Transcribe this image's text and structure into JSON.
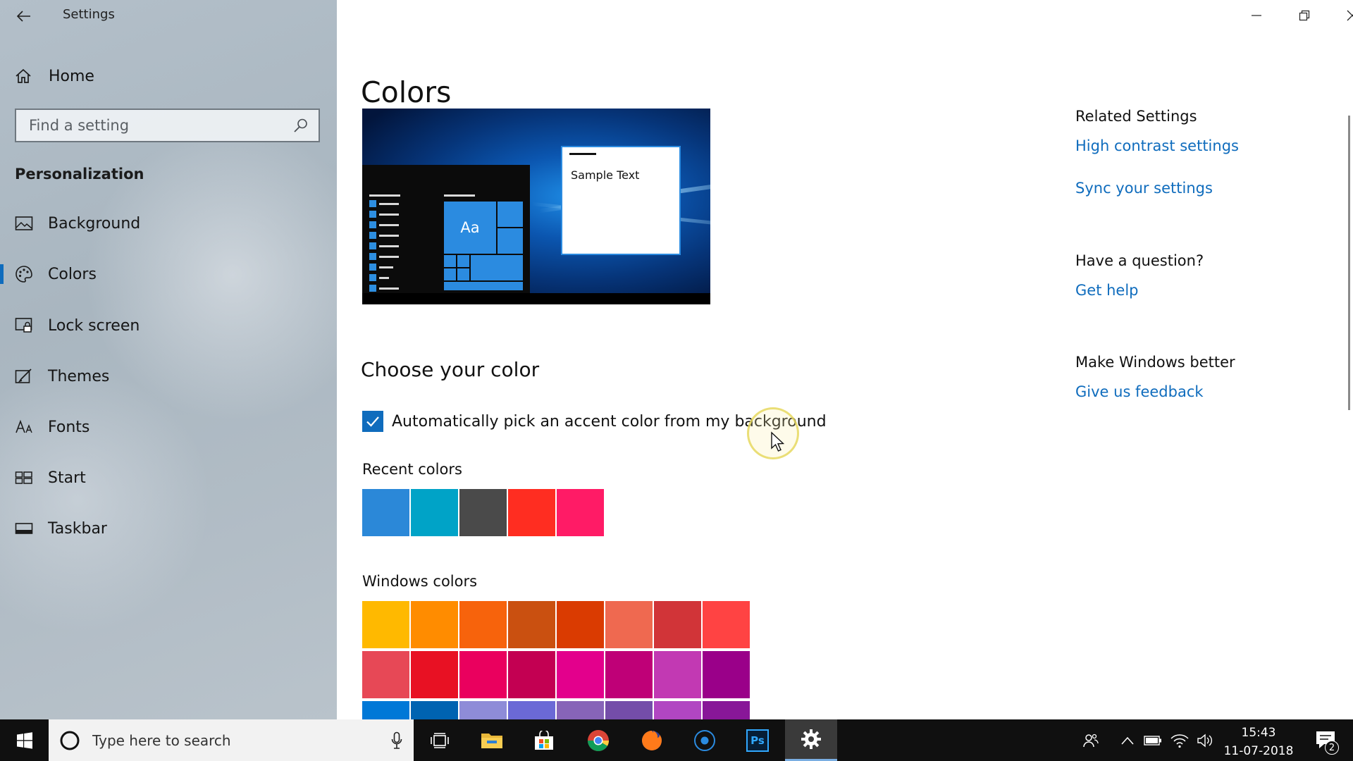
{
  "window": {
    "title": "Settings",
    "minimize_icon": "minimize-icon",
    "restore_icon": "restore-icon",
    "close_icon": "close-icon"
  },
  "sidebar": {
    "home_label": "Home",
    "search_placeholder": "Find a setting",
    "section_title": "Personalization",
    "selected": "Colors",
    "items": [
      {
        "label": "Background",
        "icon": "picture-icon"
      },
      {
        "label": "Colors",
        "icon": "palette-icon"
      },
      {
        "label": "Lock screen",
        "icon": "lock-screen-icon"
      },
      {
        "label": "Themes",
        "icon": "themes-icon"
      },
      {
        "label": "Fonts",
        "icon": "fonts-icon"
      },
      {
        "label": "Start",
        "icon": "start-icon"
      },
      {
        "label": "Taskbar",
        "icon": "taskbar-icon"
      }
    ]
  },
  "main": {
    "page_title": "Colors",
    "preview": {
      "sample_text": "Sample Text",
      "tile_text": "Aa"
    },
    "choose_title": "Choose your color",
    "auto_accent": {
      "label": "Automatically pick an accent color from my background",
      "checked": true
    },
    "recent_colors": {
      "title": "Recent colors",
      "colors": [
        "#2b88d8",
        "#00a3c7",
        "#4a4a4a",
        "#ff2d21",
        "#ff1b66"
      ]
    },
    "windows_colors": {
      "title": "Windows colors",
      "rows": [
        [
          "#ffb900",
          "#ff8c00",
          "#f7630c",
          "#ca5010",
          "#da3b01",
          "#ef6950",
          "#d13438",
          "#ff4343"
        ],
        [
          "#e74856",
          "#e81123",
          "#ea005e",
          "#c30052",
          "#e3008c",
          "#bf0077",
          "#c239b3",
          "#9a0089"
        ],
        [
          "#0078d7",
          "#0063b1",
          "#8e8cd8",
          "#6b69d6",
          "#8764b8",
          "#744da9",
          "#b146c2",
          "#881798"
        ]
      ]
    },
    "related": {
      "related_heading": "Related Settings",
      "high_contrast_link": "High contrast settings",
      "sync_link": "Sync your settings",
      "question_heading": "Have a question?",
      "help_link": "Get help",
      "better_heading": "Make Windows better",
      "feedback_link": "Give us feedback"
    },
    "accent_color": "#0f6cbd"
  },
  "taskbar": {
    "search_placeholder": "Type here to search",
    "apps": [
      "task-view-icon",
      "file-explorer-icon",
      "store-icon",
      "chrome-icon",
      "firefox-icon",
      "media-app-icon",
      "photoshop-icon",
      "settings-gear-icon"
    ],
    "photoshop_label": "Ps",
    "time": "15:43",
    "date": "11-07-2018",
    "notification_count": "2"
  }
}
